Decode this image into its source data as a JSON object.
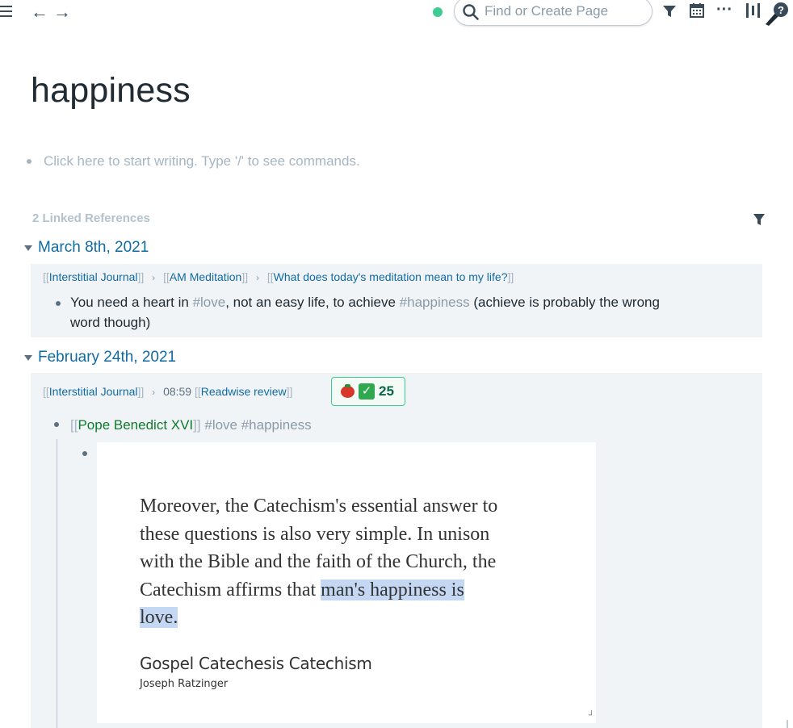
{
  "topbar": {
    "search_placeholder": "Find or Create Page",
    "back_glyph": "←",
    "forward_glyph": "→",
    "more_glyph": "···",
    "status_color": "#3dcc91"
  },
  "page": {
    "title": "happiness",
    "placeholder": "Click here to start writing. Type '/' to see commands."
  },
  "linked_refs": {
    "header": "2 Linked References",
    "groups": [
      {
        "date": "March 8th, 2021",
        "breadcrumb": [
          "Interstitial Journal",
          "AM Meditation",
          "What does today's meditation mean to my life?"
        ],
        "block": {
          "text_1": "You need a heart in ",
          "tag_1": "#love",
          "text_2": ", not an easy life, to achieve ",
          "tag_2": "#happiness",
          "text_3": " (achieve is probably the wrong",
          "text_4": "word though)"
        }
      },
      {
        "date": "February 24th, 2021",
        "breadcrumb_link_1": "Interstitial Journal",
        "time": "08:59",
        "breadcrumb_link_2": "Readwise review",
        "pomodoro_count": "25",
        "block": {
          "author_link": "Pope Benedict XVI",
          "tags": "#love #happiness"
        },
        "quote": {
          "line_1": "Moreover, the Catechism's essential answer to",
          "line_2": "these questions is also very simple. In unison",
          "line_3": "with the Bible and the faith of the Church, the",
          "line_4_plain": "Catechism affirms that ",
          "line_4_highlight": "man's happiness is",
          "line_5_highlight": "love.",
          "source_title": "Gospel Catechesis Catechism",
          "source_author": "Joseph Ratzinger"
        }
      }
    ]
  },
  "colors": {
    "link": "#106ba3",
    "tag": "#8a9ba8",
    "highlight": "#c5d8f3",
    "ref_background": "#f1f4f7"
  }
}
